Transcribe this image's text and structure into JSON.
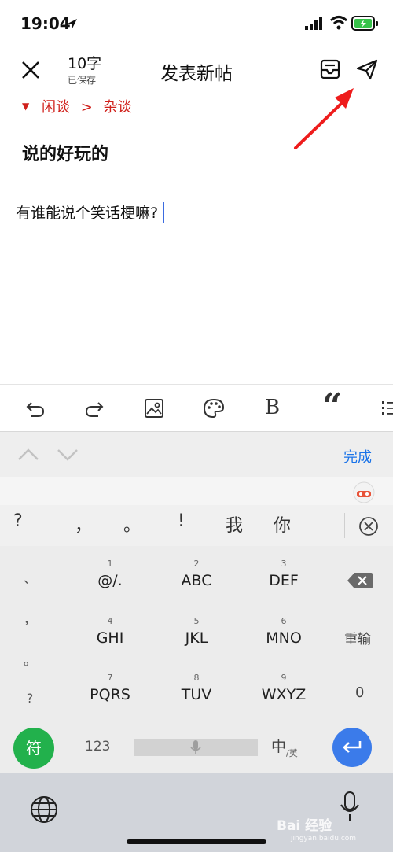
{
  "status": {
    "time": "19:04"
  },
  "header": {
    "word_count": "10字",
    "saved": "已保存",
    "title": "发表新帖"
  },
  "category": {
    "board": "闲谈",
    "separator": ">",
    "sub": "杂谈"
  },
  "post": {
    "title": "说的好玩的",
    "body": "有谁能说个笑话梗嘛?"
  },
  "keyboard": {
    "done": "完成",
    "candidates": [
      "?",
      "，",
      "。",
      "!",
      "我",
      "你"
    ],
    "side_punct": [
      "、",
      "，",
      "。",
      "?"
    ],
    "keys": [
      {
        "num": "1",
        "label": "@/."
      },
      {
        "num": "2",
        "label": "ABC"
      },
      {
        "num": "3",
        "label": "DEF"
      },
      {
        "num": "4",
        "label": "GHI"
      },
      {
        "num": "5",
        "label": "JKL"
      },
      {
        "num": "6",
        "label": "MNO"
      },
      {
        "num": "7",
        "label": "PQRS"
      },
      {
        "num": "8",
        "label": "TUV"
      },
      {
        "num": "9",
        "label": "WXYZ"
      }
    ],
    "reinput": "重输",
    "zero": "0",
    "symbol": "符",
    "num_toggle": "123",
    "lang_main": "中",
    "lang_sub": "/英"
  },
  "watermark": {
    "text": "Bai 经验",
    "sub": "jingyan.baidu.com"
  },
  "colors": {
    "accent_red": "#d0211c",
    "blue": "#1a73e8",
    "green": "#22b14c",
    "enter_blue": "#3b7bea",
    "arrow_red": "#ee1c1c"
  }
}
